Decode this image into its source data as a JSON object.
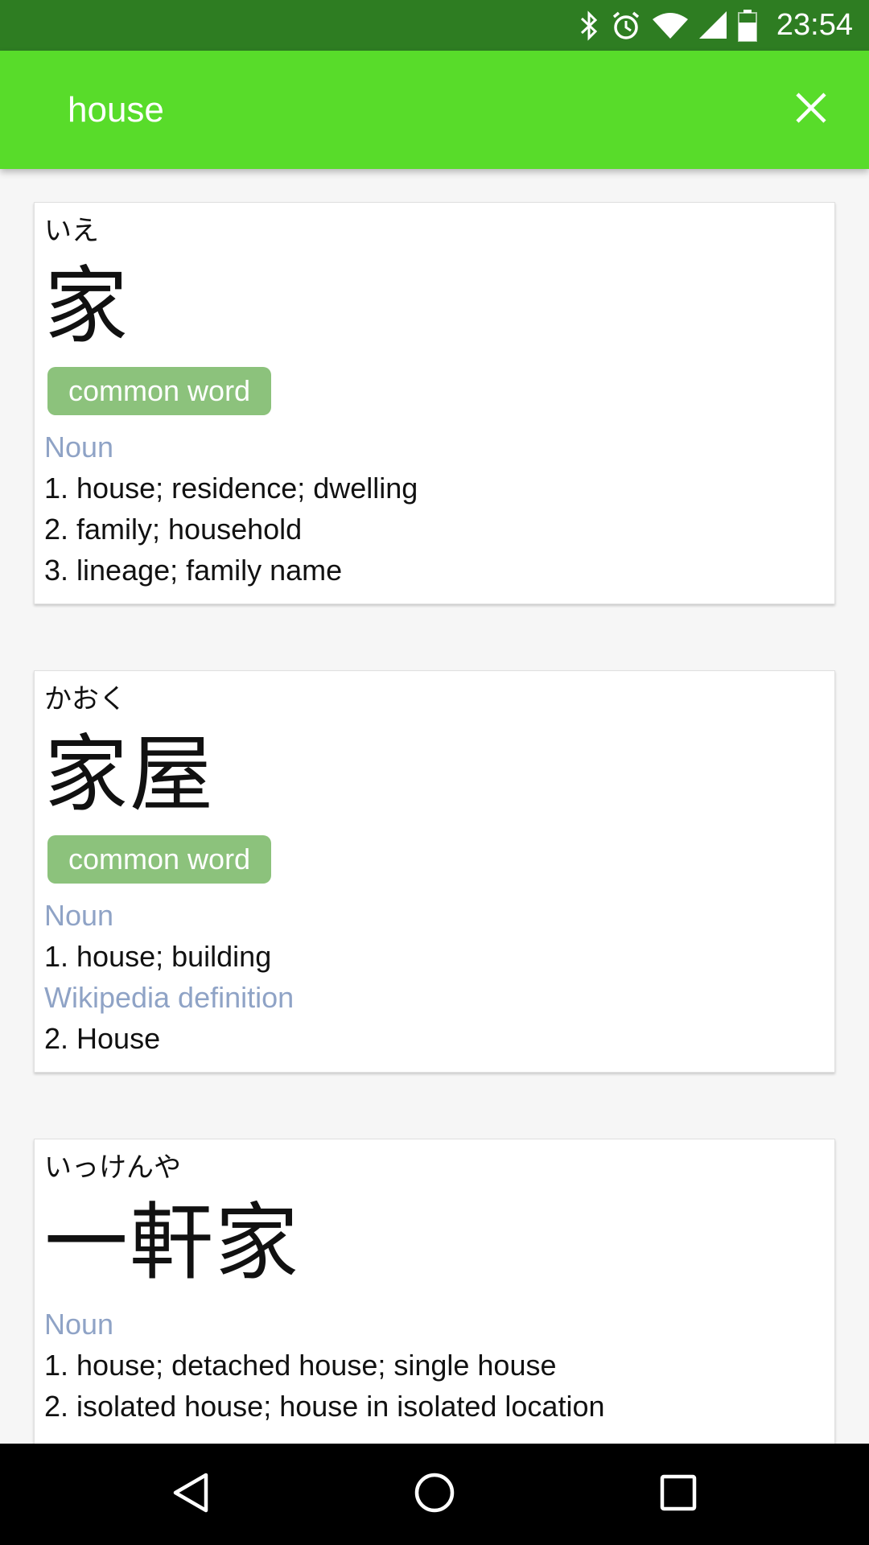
{
  "status_bar": {
    "time": "23:54",
    "icons": [
      "bluetooth-icon",
      "alarm-icon",
      "wifi-icon",
      "cell-signal-icon",
      "battery-icon"
    ]
  },
  "app_bar": {
    "query": "house",
    "close_icon": "close-icon"
  },
  "results": [
    {
      "reading": "いえ",
      "word": "家",
      "badge": "common word",
      "pos1": "Noun",
      "defs": [
        "1. house; residence; dwelling",
        "2. family; household",
        "3. lineage; family name"
      ]
    },
    {
      "reading": "かおく",
      "word": "家屋",
      "badge": "common word",
      "pos1": "Noun",
      "defs": [
        "1. house; building"
      ],
      "pos2": "Wikipedia definition",
      "defs2": [
        "2. House"
      ]
    },
    {
      "reading": "いっけんや",
      "word": "一軒家",
      "pos1": "Noun",
      "defs": [
        "1. house; detached house; single house",
        "2. isolated house; house in isolated location"
      ]
    }
  ],
  "nav_bar": {
    "back": "back-icon",
    "home": "home-icon",
    "recents": "recents-icon"
  },
  "colors": {
    "status_bar": "#2e7d22",
    "app_bar": "#58dc2a",
    "badge": "#8cc27c",
    "pos_label": "#8fa3c6"
  }
}
